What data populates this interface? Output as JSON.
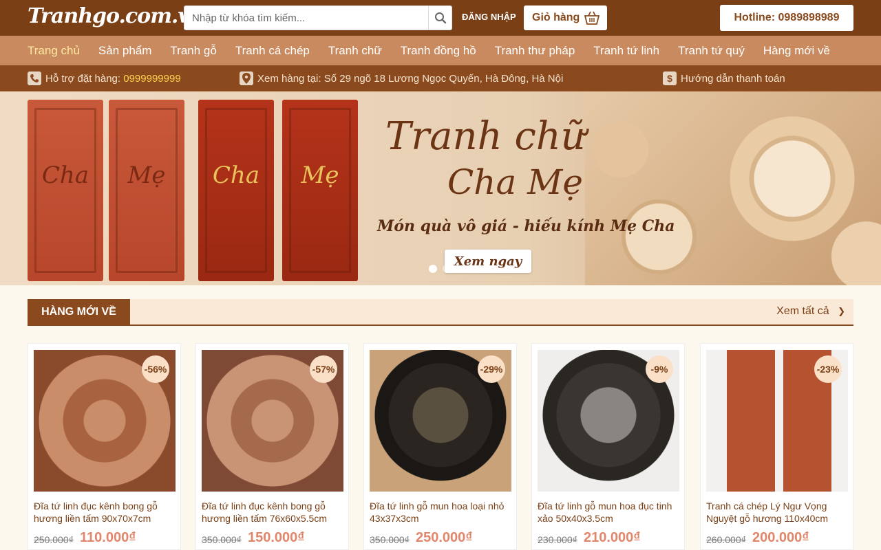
{
  "header": {
    "logo_text": "Tranhgo.com.vn",
    "search_placeholder": "Nhập từ khóa tìm kiếm...",
    "login_label": "ĐĂNG NHẬP",
    "cart_label": "Giỏ hàng",
    "hotline": "Hotline: 0989898989"
  },
  "nav": {
    "items": [
      {
        "label": "Trang chủ",
        "active": true
      },
      {
        "label": "Sản phẩm"
      },
      {
        "label": "Tranh gỗ"
      },
      {
        "label": "Tranh cá chép"
      },
      {
        "label": "Tranh chữ"
      },
      {
        "label": "Tranh đồng hồ"
      },
      {
        "label": "Tranh thư pháp"
      },
      {
        "label": "Tranh tứ linh"
      },
      {
        "label": "Tranh tứ quý"
      },
      {
        "label": "Hàng mới về"
      }
    ]
  },
  "infobar": {
    "support_label": "Hỗ trợ đặt hàng:",
    "support_phone": "0999999999",
    "address": "Xem hàng tại: Số 29 ngõ 18 Lương Ngọc Quyến, Hà Đông, Hà Nội",
    "payment_guide": "Hướng dẫn thanh toán"
  },
  "banner": {
    "title_line1": "Tranh chữ",
    "title_line2": "Cha Mẹ",
    "subtitle": "Món quà vô giá - hiếu kính Mẹ Cha",
    "button": "Xem ngay",
    "panel_words": [
      "Cha",
      "Mẹ",
      "Cha",
      "Mẹ"
    ]
  },
  "section": {
    "title": "HÀNG MỚI VỀ",
    "more": "Xem tất cả"
  },
  "products": [
    {
      "name": "Đĩa tứ linh đục kênh bong gỗ hương liền tấm 90x70x7cm",
      "old_price": "250.000₫",
      "price": "110.000₫",
      "discount": "-56%"
    },
    {
      "name": "Đĩa tứ linh đục kênh bong gỗ hương liền tấm 76x60x5.5cm",
      "old_price": "350.000₫",
      "price": "150.000₫",
      "discount": "-57%"
    },
    {
      "name": "Đĩa tứ linh gỗ mun hoa loại nhỏ 43x37x3cm",
      "old_price": "350.000₫",
      "price": "250.000₫",
      "discount": "-29%"
    },
    {
      "name": "Đĩa tứ linh gỗ mun hoa đục tinh xảo 50x40x3.5cm",
      "old_price": "230.000₫",
      "price": "210.000₫",
      "discount": "-9%"
    },
    {
      "name": "Tranh cá chép Lý Ngư Vọng Nguyệt gỗ hương 110x40cm",
      "old_price": "260.000₫",
      "price": "200.000₫",
      "discount": "-23%"
    }
  ],
  "colors": {
    "brand_dark": "#7a3f15",
    "nav_bg": "#c88a5e",
    "price": "#e0866a"
  }
}
